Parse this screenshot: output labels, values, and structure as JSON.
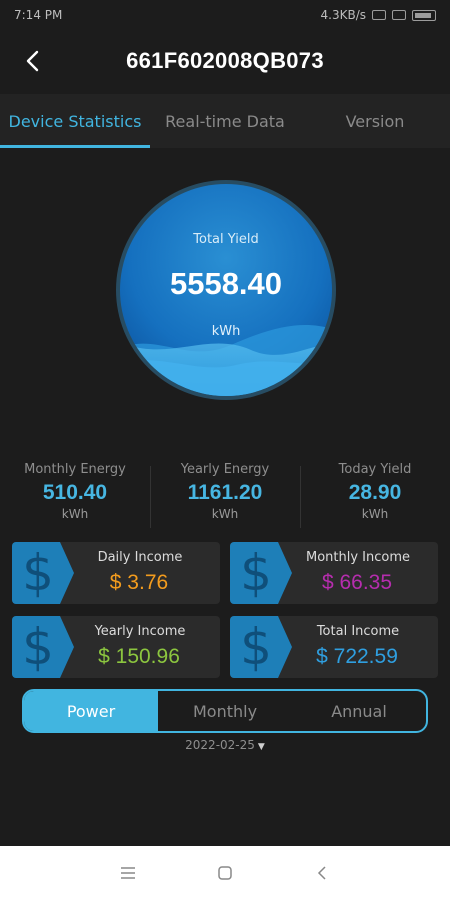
{
  "status_bar": {
    "time": "7:14 PM",
    "network": "4.3KB/s"
  },
  "header": {
    "title": "661F602008QB073"
  },
  "tabs": [
    {
      "label": "Device Statistics",
      "active": true
    },
    {
      "label": "Real-time Data",
      "active": false
    },
    {
      "label": "Version",
      "active": false
    }
  ],
  "gauge": {
    "label": "Total Yield",
    "value": "5558.40",
    "unit": "kWh"
  },
  "stats": [
    {
      "label": "Monthly Energy",
      "value": "510.40",
      "unit": "kWh"
    },
    {
      "label": "Yearly Energy",
      "value": "1161.20",
      "unit": "kWh"
    },
    {
      "label": "Today Yield",
      "value": "28.90",
      "unit": "kWh"
    }
  ],
  "income": [
    {
      "label": "Daily Income",
      "value": "$ 3.76",
      "color": "#f39c1e"
    },
    {
      "label": "Monthly Income",
      "value": "$ 66.35",
      "color": "#b62dae"
    },
    {
      "label": "Yearly Income",
      "value": "$ 150.96",
      "color": "#8cc63f"
    },
    {
      "label": "Total Income",
      "value": "$ 722.59",
      "color": "#2f9fe0"
    }
  ],
  "segment": [
    {
      "label": "Power",
      "active": true
    },
    {
      "label": "Monthly",
      "active": false
    },
    {
      "label": "Annual",
      "active": false
    }
  ],
  "date": "2022-02-25",
  "colors": {
    "accent": "#41b5e0",
    "background": "#1c1c1c",
    "card": "#2b2b2b"
  },
  "icons": {
    "back": "chevron-left-icon",
    "dollar": "dollar-icon",
    "dropdown": "caret-down-icon"
  }
}
